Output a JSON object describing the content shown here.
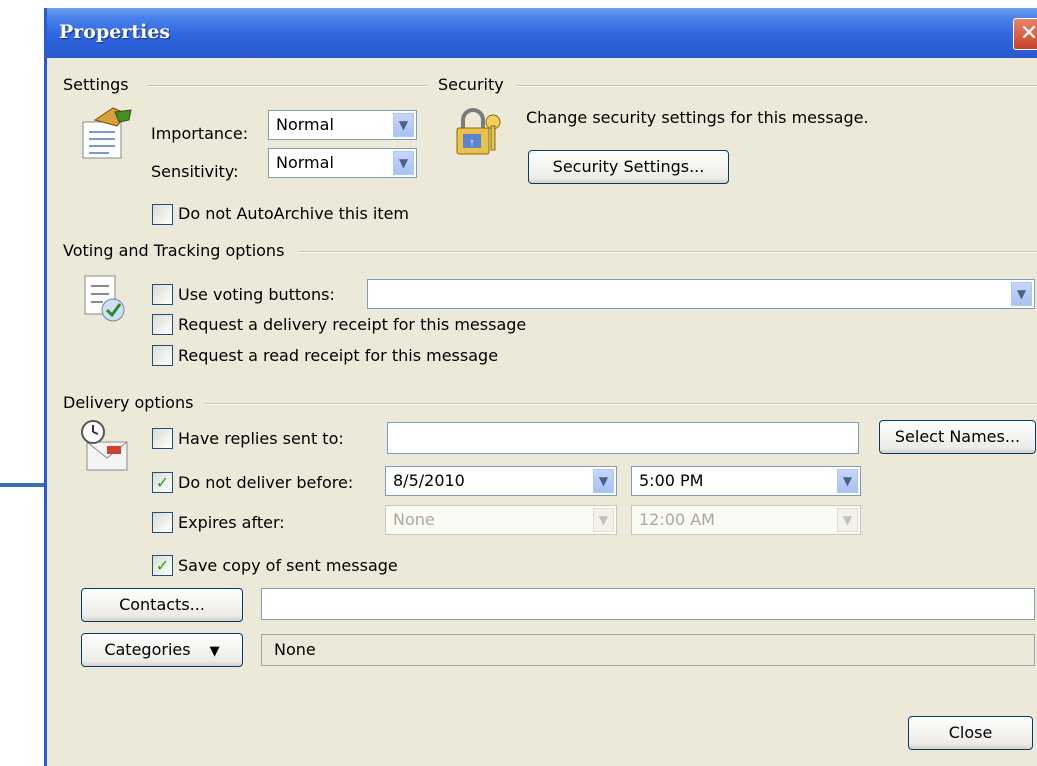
{
  "window": {
    "title": "Properties",
    "close_symbol": "✕"
  },
  "settings": {
    "group_label": "Settings",
    "importance_label": "Importance:",
    "importance_value": "Normal",
    "sensitivity_label": "Sensitivity:",
    "sensitivity_value": "Normal",
    "autoarchive": {
      "label": "Do not AutoArchive this item",
      "checked": false
    }
  },
  "security": {
    "group_label": "Security",
    "description": "Change security settings for this message.",
    "button_label": "Security Settings..."
  },
  "voting": {
    "group_label": "Voting and Tracking options",
    "use_voting": {
      "label": "Use voting buttons:",
      "checked": false,
      "value": ""
    },
    "delivery_receipt": {
      "label": "Request a delivery receipt for this message",
      "checked": false
    },
    "read_receipt": {
      "label": "Request a read receipt for this message",
      "checked": false
    }
  },
  "delivery": {
    "group_label": "Delivery options",
    "replies": {
      "label": "Have replies sent to:",
      "checked": false,
      "value": ""
    },
    "select_names_label": "Select Names...",
    "deliver_before": {
      "label": "Do not deliver before:",
      "checked": true,
      "date": "8/5/2010",
      "time": "5:00 PM"
    },
    "expires": {
      "label": "Expires after:",
      "checked": false,
      "date": "None",
      "time": "12:00 AM"
    },
    "save_copy": {
      "label": "Save copy of sent message",
      "checked": true
    }
  },
  "contacts": {
    "button_label": "Contacts...",
    "value": ""
  },
  "categories": {
    "button_label": "Categories",
    "arrow": "▼",
    "value": "None"
  },
  "footer": {
    "close_label": "Close"
  },
  "icons": {
    "importance": "importance-icon",
    "security": "lock-key-icon",
    "voting": "voting-icon",
    "delivery": "envelope-clock-icon",
    "arrow": "blue-arrow-annotation"
  },
  "colors": {
    "titlebar": "#2f66df",
    "dialog_bg": "#ECE9D8",
    "arrow": "#3a6fb0",
    "check": "#21a121"
  }
}
